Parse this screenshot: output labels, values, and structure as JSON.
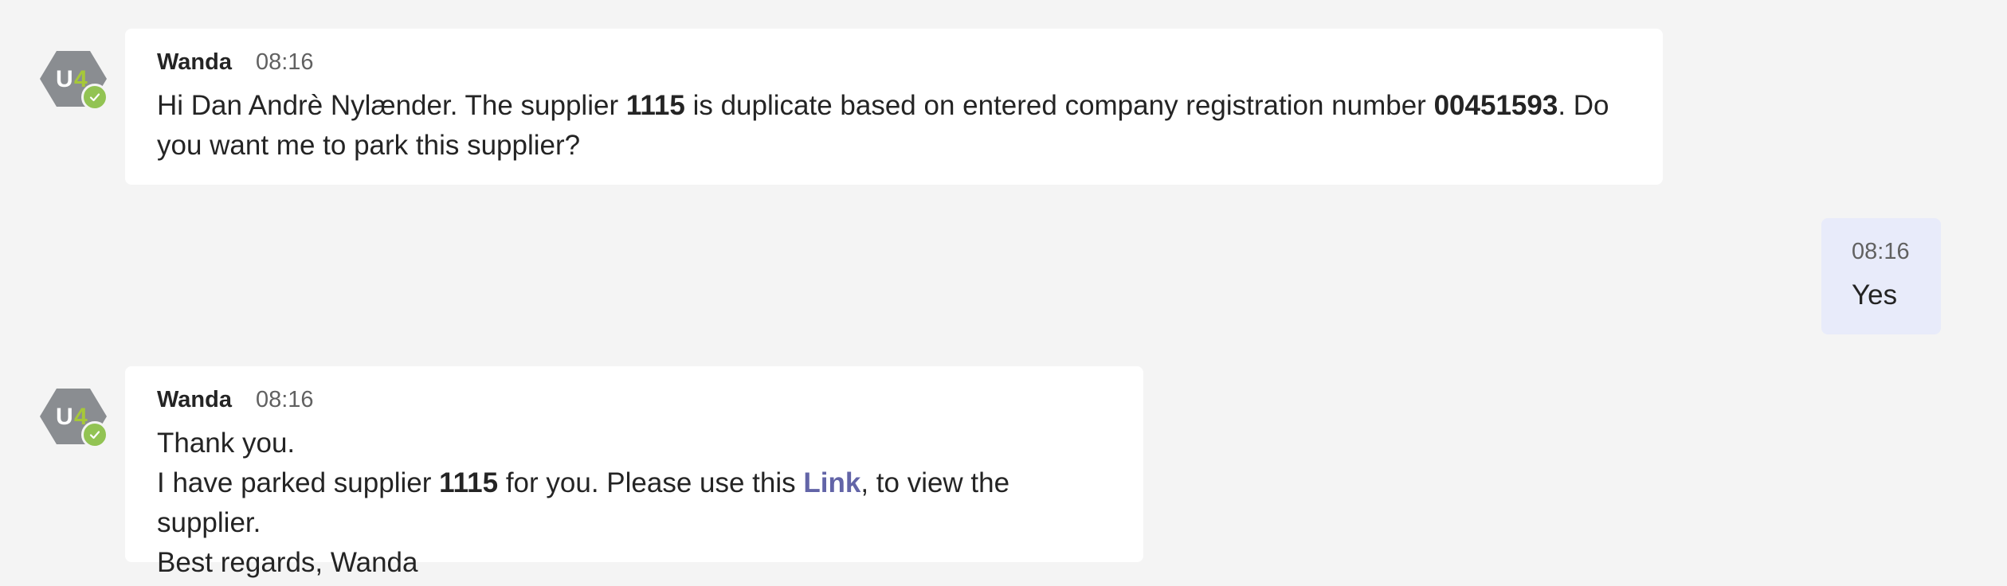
{
  "messages": [
    {
      "sender": "Wanda",
      "time": "08:16",
      "avatar": {
        "icon": "u4-logo-icon",
        "presence": "available"
      },
      "lines": {
        "t1": "Hi Dan Andrè Nylænder. The supplier ",
        "b1": "1115",
        "t2": " is duplicate based on entered company registration number ",
        "b2": "00451593",
        "t3": ". Do you want me to park this supplier?"
      }
    },
    {
      "sender": "",
      "time": "08:16",
      "text": "Yes"
    },
    {
      "sender": "Wanda",
      "time": "08:16",
      "avatar": {
        "icon": "u4-logo-icon",
        "presence": "available"
      },
      "lines": {
        "line1": "Thank you.",
        "l2a": "I have parked supplier ",
        "l2b": "1115",
        "l2c": " for you. Please use this ",
        "link": "Link",
        "l2d": ", to view the supplier.",
        "line3": "Best regards, Wanda"
      }
    }
  ],
  "colors": {
    "background": "#f4f4f4",
    "bubble": "#ffffff",
    "own_bubble": "#e8ebfa",
    "link": "#6264a7",
    "presence": "#92c353",
    "avatar": "#8a8d91",
    "logo_accent": "#a6c839"
  }
}
